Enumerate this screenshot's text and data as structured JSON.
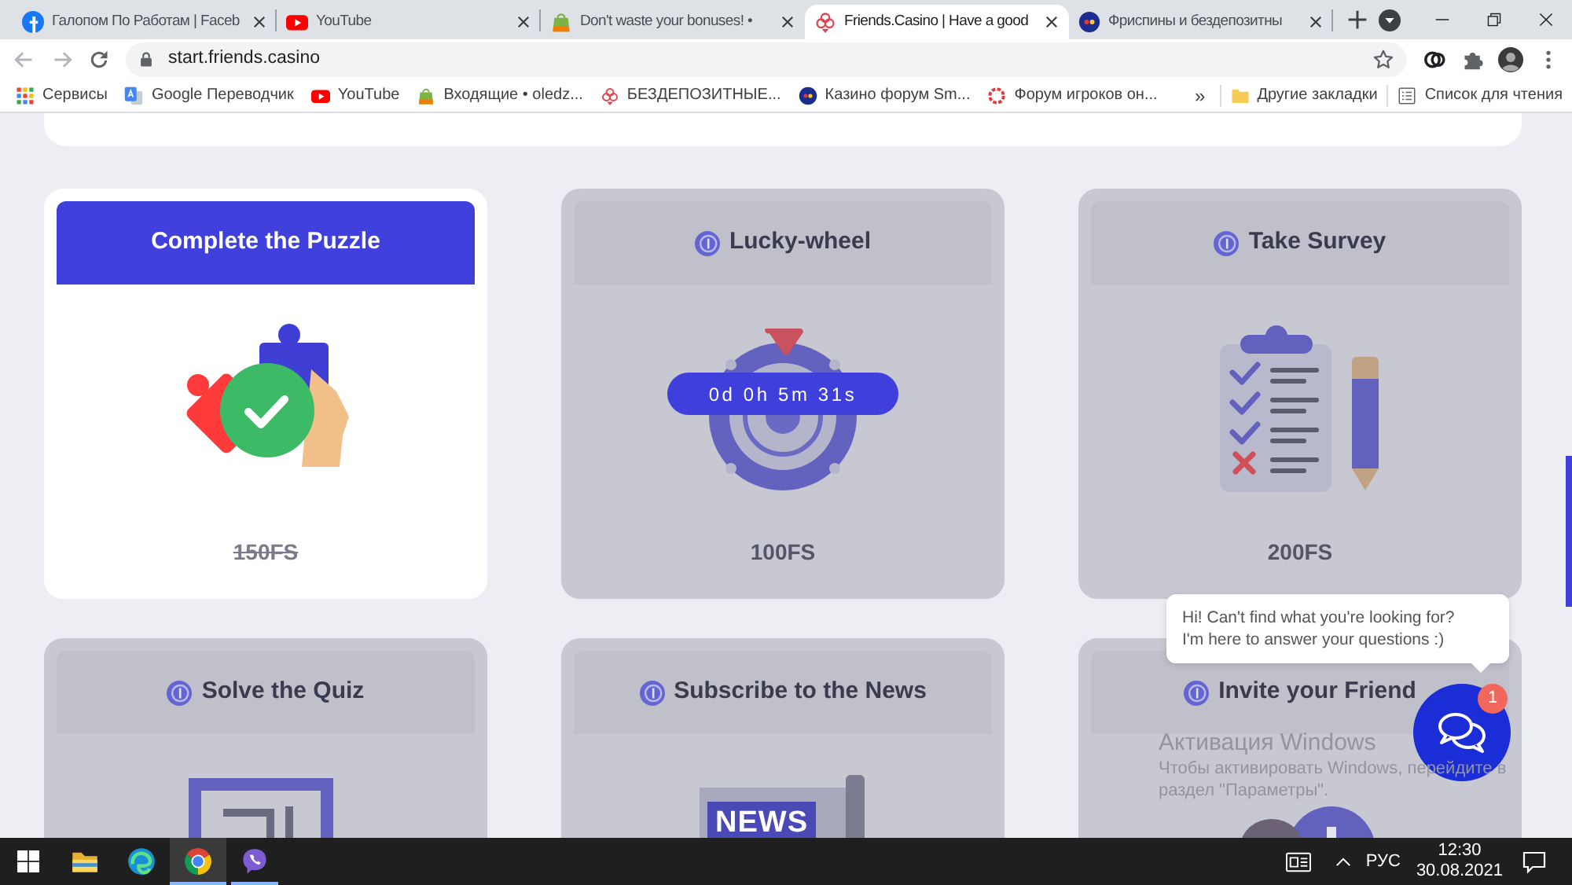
{
  "browser": {
    "tabs": [
      {
        "title": "Галопом По Работам | Faceb",
        "kind": "fbadge",
        "selected": false
      },
      {
        "title": "YouTube",
        "kind": "play",
        "selected": false
      },
      {
        "title": "Don't waste your bonuses! •",
        "kind": "bag",
        "selected": false
      },
      {
        "title": "Friends.Casino | Have a good",
        "kind": "flower",
        "selected": true
      },
      {
        "title": "Фриспины и бездепозитны",
        "kind": "ball",
        "selected": false
      }
    ],
    "address": "start.friends.casino",
    "bookmarks": [
      {
        "label": "Сервисы",
        "kind": "grid"
      },
      {
        "label": "Google Переводчик",
        "kind": "translate"
      },
      {
        "label": "YouTube",
        "kind": "play"
      },
      {
        "label": "Входящие • oledz...",
        "kind": "bag"
      },
      {
        "label": "БЕЗДЕПОЗИТНЫЕ...",
        "kind": "flower"
      },
      {
        "label": "Казино форум Sm...",
        "kind": "ball"
      },
      {
        "label": "Форум игроков он...",
        "kind": "ring"
      }
    ],
    "more": "»",
    "other_bookmarks": "Другие закладки",
    "reading_list": "Список для чтения"
  },
  "cards": [
    {
      "title": "Complete the Puzzle",
      "reward": "150FS",
      "kind": "puzzle",
      "completed": true
    },
    {
      "title": "Lucky-wheel",
      "reward": "100FS",
      "kind": "wheel",
      "completed": false,
      "timer": "0d 0h 5m 31s"
    },
    {
      "title": "Take Survey",
      "reward": "200FS",
      "kind": "survey",
      "completed": false
    },
    {
      "title": "Solve the Quiz",
      "kind": "quiz",
      "completed": false
    },
    {
      "title": "Subscribe to the News",
      "kind": "news",
      "completed": false,
      "art_label": "NEWS"
    },
    {
      "title": "Invite your Friend",
      "kind": "invite",
      "completed": false
    }
  ],
  "chat": {
    "tooltip": [
      "Hi! Can't find what you're looking for?",
      "I'm here to answer your questions :)"
    ],
    "unread": "1"
  },
  "activation_notice": {
    "title": "Активация Windows",
    "lines": [
      "Чтобы активировать Windows, перейдите в",
      "раздел \"Параметры\"."
    ]
  },
  "taskbar": {
    "apps": [
      {
        "kind": "folder",
        "selected": false,
        "running": false
      },
      {
        "kind": "swirl",
        "selected": false,
        "running": false
      },
      {
        "kind": "segmented",
        "selected": true,
        "running": true
      },
      {
        "kind": "phone",
        "selected": false,
        "running": true
      }
    ],
    "language": "РУС",
    "time": "12:30",
    "date": "30.08.2021"
  }
}
